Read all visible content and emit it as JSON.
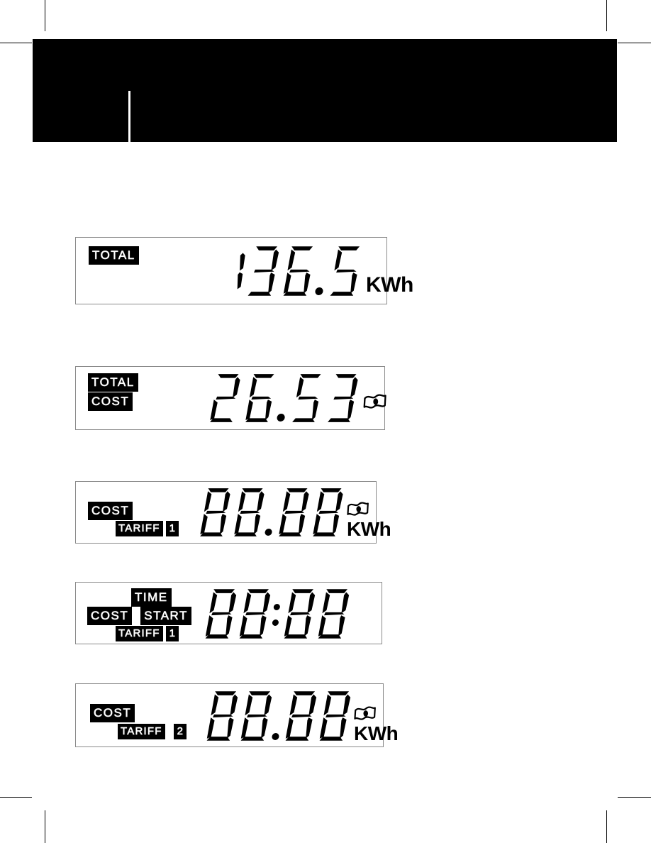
{
  "page": {
    "background_color": "#ffffff",
    "header_color": "#000000",
    "panel_border_color": "#8a8a8a",
    "segment_color": "#000000",
    "badge_background": "#000000",
    "badge_text_color": "#ffffff"
  },
  "header": {
    "band_label": "black-header-band",
    "divider_label": "white-vertical-divider"
  },
  "crop_marks": {
    "label": "printer-registration-marks",
    "count": 8
  },
  "lcd_panels": [
    {
      "id": "panel-total-kwh",
      "badges": [
        {
          "text": "TOTAL",
          "row": 0
        }
      ],
      "value": "136.5",
      "digits": [
        "1",
        "3",
        "6",
        ".",
        "5"
      ],
      "separator": "decimal",
      "unit": "KWh",
      "money_icon": false
    },
    {
      "id": "panel-total-cost",
      "badges": [
        {
          "text": "TOTAL",
          "row": 0
        },
        {
          "text": "COST",
          "row": 1
        }
      ],
      "value": "26.53",
      "digits": [
        "2",
        "6",
        ".",
        "5",
        "3"
      ],
      "separator": "decimal",
      "unit": "",
      "money_icon": true
    },
    {
      "id": "panel-cost-tariff-1",
      "badges": [
        {
          "text": "COST",
          "row": 0
        },
        {
          "text": "TARIFF",
          "row": 1
        },
        {
          "text": "1",
          "row": 1
        }
      ],
      "value": "88.88",
      "digits": [
        "8",
        "8",
        ".",
        "8",
        "8"
      ],
      "separator": "decimal",
      "unit": "KWh",
      "money_icon": true
    },
    {
      "id": "panel-cost-start-time-tariff-1",
      "badges": [
        {
          "text": "TIME",
          "row": 0
        },
        {
          "text": "COST",
          "row": 1
        },
        {
          "text": "START",
          "row": 1
        },
        {
          "text": "TARIFF",
          "row": 2
        },
        {
          "text": "1",
          "row": 2
        }
      ],
      "value": "88:88",
      "digits": [
        "8",
        "8",
        ":",
        "8",
        "8"
      ],
      "separator": "colon",
      "unit": "",
      "money_icon": false
    },
    {
      "id": "panel-cost-tariff-2",
      "badges": [
        {
          "text": "COST",
          "row": 0
        },
        {
          "text": "TARIFF",
          "row": 1
        },
        {
          "text": "2",
          "row": 1
        }
      ],
      "value": "88.88",
      "digits": [
        "8",
        "8",
        ".",
        "8",
        "8"
      ],
      "separator": "decimal",
      "unit": "KWh",
      "money_icon": true
    }
  ]
}
